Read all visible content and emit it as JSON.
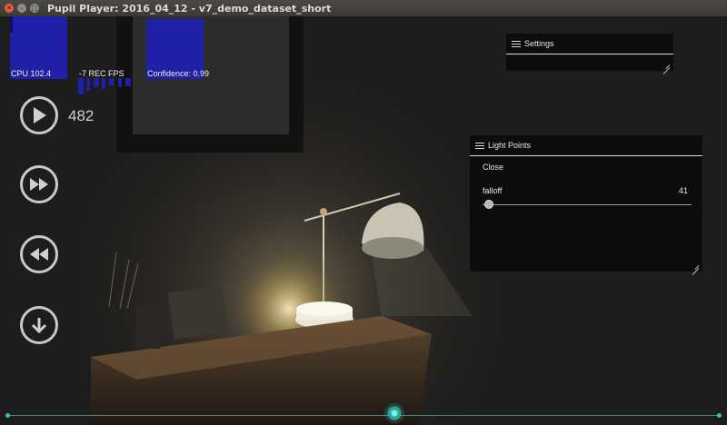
{
  "window": {
    "title": "Pupil Player: 2016_04_12 - v7_demo_dataset_short",
    "close_glyph": "✕",
    "minimize_glyph": "–",
    "maximize_glyph": "□"
  },
  "graphs": {
    "cpu_label": "CPU 102.4",
    "fps_label": "-7 REC FPS",
    "confidence_label": "Confidence: 0.99",
    "bar_color": "#1f1fa8"
  },
  "playback": {
    "frame": "482",
    "icons": [
      "play-icon",
      "fast-forward-icon",
      "rewind-icon",
      "download-icon"
    ]
  },
  "settings_menu": {
    "title": "Settings"
  },
  "light_points_menu": {
    "title": "Light Points",
    "close_label": "Close",
    "slider_label": "falloff",
    "slider_value": "41"
  },
  "seek": {
    "accent": "#2aa79e"
  }
}
